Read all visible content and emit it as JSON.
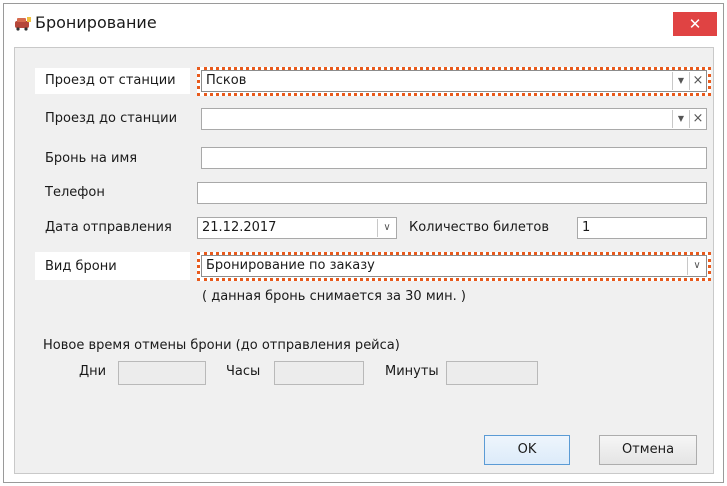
{
  "window": {
    "title": "Бронирование",
    "close_label": "✕"
  },
  "form": {
    "from_station": {
      "label": "Проезд от станции",
      "value": "Псков"
    },
    "to_station": {
      "label": "Проезд до станции",
      "value": ""
    },
    "booking_name": {
      "label": "Бронь на имя",
      "value": ""
    },
    "phone": {
      "label": "Телефон",
      "value": ""
    },
    "departure_date": {
      "label": "Дата отправления",
      "value": "21.12.2017"
    },
    "ticket_count": {
      "label": "Количество билетов",
      "value": "1"
    },
    "booking_type": {
      "label": "Вид брони",
      "value": "Бронирование по заказу",
      "note": "( данная бронь снимается за 30 мин. )"
    },
    "cancel_time": {
      "heading": "Новое время отмены брони (до отправления рейса)",
      "days_label": "Дни",
      "hours_label": "Часы",
      "minutes_label": "Минуты"
    }
  },
  "buttons": {
    "ok": "OK",
    "cancel": "Отмена"
  },
  "icons": {
    "dropdown": "▼",
    "clear": "×",
    "chevron": "∨"
  },
  "colors": {
    "highlight": "#e85a1c",
    "close": "#e04343"
  }
}
